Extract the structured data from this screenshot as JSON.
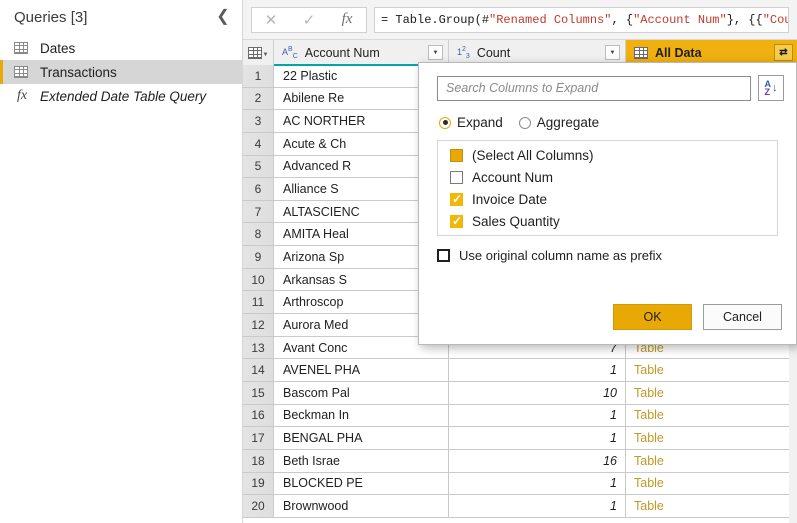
{
  "queries_pane": {
    "title": "Queries [3]",
    "collapse_icon": "chevron-left-icon",
    "items": [
      {
        "label": "Dates",
        "icon": "table-icon",
        "italic": false,
        "selected": false
      },
      {
        "label": "Transactions",
        "icon": "table-icon",
        "italic": false,
        "selected": true
      },
      {
        "label": "Extended Date Table Query",
        "icon": "fx-icon",
        "italic": true,
        "selected": false
      }
    ]
  },
  "formula_bar": {
    "cancel_icon": "close-icon",
    "accept_icon": "check-icon",
    "fx_icon": "fx-icon",
    "formula": "= Table.Group(#\"Renamed Columns\", {\"Account Num\"}, {{\"Count",
    "formula_parts": [
      {
        "t": "= Table.Group(#",
        "k": "punc"
      },
      {
        "t": "\"Renamed Columns\"",
        "k": "str"
      },
      {
        "t": ", {",
        "k": "punc"
      },
      {
        "t": "\"Account Num\"",
        "k": "str"
      },
      {
        "t": "}, {{",
        "k": "punc"
      },
      {
        "t": "\"Count",
        "k": "str"
      }
    ]
  },
  "grid": {
    "columns": [
      {
        "name": "Account Num",
        "type_icon": "ABC",
        "type": "text",
        "has_filter": true
      },
      {
        "name": "Count",
        "type_icon": "123",
        "type": "whole-number",
        "has_filter": true
      },
      {
        "name": "All Data",
        "type_icon": "table-icon",
        "type": "table",
        "has_expand": true,
        "highlighted": true
      }
    ],
    "rows": [
      {
        "n": "1",
        "account": "22 Plastic",
        "count": "",
        "all_data": ""
      },
      {
        "n": "2",
        "account": "Abilene Re",
        "count": "",
        "all_data": ""
      },
      {
        "n": "3",
        "account": "AC NORTHER",
        "count": "",
        "all_data": ""
      },
      {
        "n": "4",
        "account": "Acute & Ch",
        "count": "",
        "all_data": ""
      },
      {
        "n": "5",
        "account": "Advanced R",
        "count": "",
        "all_data": ""
      },
      {
        "n": "6",
        "account": "Alliance S",
        "count": "",
        "all_data": ""
      },
      {
        "n": "7",
        "account": "ALTASCIENC",
        "count": "",
        "all_data": ""
      },
      {
        "n": "8",
        "account": "AMITA Heal",
        "count": "",
        "all_data": ""
      },
      {
        "n": "9",
        "account": "Arizona Sp",
        "count": "",
        "all_data": ""
      },
      {
        "n": "10",
        "account": "Arkansas S",
        "count": "",
        "all_data": ""
      },
      {
        "n": "11",
        "account": "Arthroscop",
        "count": "",
        "all_data": ""
      },
      {
        "n": "12",
        "account": "Aurora Med",
        "count": "",
        "all_data": ""
      },
      {
        "n": "13",
        "account": "Avant Conc",
        "count": "7",
        "all_data": "Table"
      },
      {
        "n": "14",
        "account": "AVENEL PHA",
        "count": "1",
        "all_data": "Table"
      },
      {
        "n": "15",
        "account": "Bascom Pal",
        "count": "10",
        "all_data": "Table"
      },
      {
        "n": "16",
        "account": "Beckman In",
        "count": "1",
        "all_data": "Table"
      },
      {
        "n": "17",
        "account": "BENGAL PHA",
        "count": "1",
        "all_data": "Table"
      },
      {
        "n": "18",
        "account": "Beth Israe",
        "count": "16",
        "all_data": "Table"
      },
      {
        "n": "19",
        "account": "BLOCKED PE",
        "count": "1",
        "all_data": "Table"
      },
      {
        "n": "20",
        "account": "Brownwood",
        "count": "1",
        "all_data": "Table"
      }
    ]
  },
  "expand_dialog": {
    "search_placeholder": "Search Columns to Expand",
    "search_value": "",
    "sort_icon": "sort-az-icon",
    "mode_options": [
      {
        "label": "Expand",
        "selected": true
      },
      {
        "label": "Aggregate",
        "selected": false
      }
    ],
    "columns": [
      {
        "label": "(Select All Columns)",
        "state": "indeterminate"
      },
      {
        "label": "Account Num",
        "state": "unchecked"
      },
      {
        "label": "Invoice Date",
        "state": "checked"
      },
      {
        "label": "Sales Quantity",
        "state": "checked"
      }
    ],
    "prefix_option": {
      "label": "Use original column name as prefix",
      "checked": false
    },
    "ok_label": "OK",
    "cancel_label": "Cancel"
  },
  "colors": {
    "accent_amber": "#e8a805",
    "header_highlight": "#efb010",
    "teal_accent": "#00A7A7",
    "table_link": "#c09a26",
    "selection_gray": "#d6d6d6"
  }
}
